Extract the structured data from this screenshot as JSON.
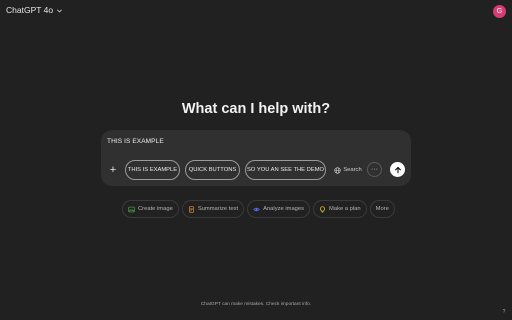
{
  "header": {
    "model_name": "ChatGPT 4o",
    "avatar_initial": "G"
  },
  "main": {
    "heading": "What can I help with?"
  },
  "composer": {
    "input_text": "THIS IS EXAMPLE",
    "chips": [
      "THIS IS EXAMPLE",
      "QUICK BUTTONS",
      "SO YOU AN SEE THE DEMO"
    ],
    "search_label": "Search"
  },
  "actions": [
    {
      "label": "Create image",
      "icon": "image-icon",
      "color": "#4caf50"
    },
    {
      "label": "Summarize text",
      "icon": "document-icon",
      "color": "#e08a3c"
    },
    {
      "label": "Analyze images",
      "icon": "eye-icon",
      "color": "#5b6cff"
    },
    {
      "label": "Make a plan",
      "icon": "lightbulb-icon",
      "color": "#e6c23c"
    },
    {
      "label": "More",
      "icon": "",
      "color": ""
    }
  ],
  "footer": {
    "disclaimer": "ChatGPT can make mistakes. Check important info."
  },
  "colors": {
    "background": "#212121",
    "composer": "#303030",
    "avatar": "#d63b73"
  }
}
